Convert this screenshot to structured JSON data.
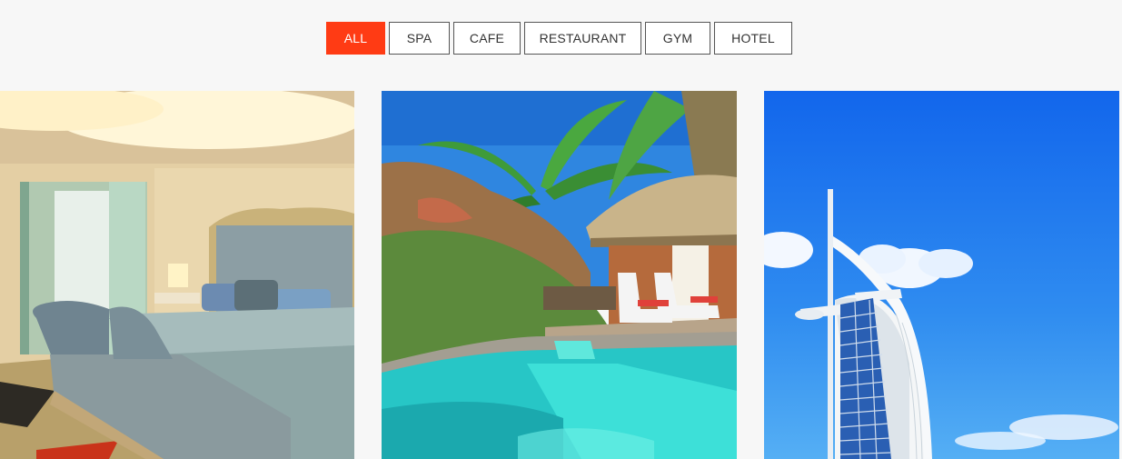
{
  "filters": {
    "active": "ALL",
    "items": [
      {
        "label": "ALL"
      },
      {
        "label": "SPA"
      },
      {
        "label": "CAFE"
      },
      {
        "label": "RESTAURANT"
      },
      {
        "label": "GYM"
      },
      {
        "label": "HOTEL"
      }
    ]
  },
  "gallery": {
    "items": [
      {
        "subject": "hotel-bedroom"
      },
      {
        "subject": "resort-pool-villa"
      },
      {
        "subject": "burj-al-arab-hotel"
      }
    ]
  },
  "colors": {
    "accent": "#ff3b14",
    "page_background": "#f7f7f7",
    "button_border": "#555555"
  }
}
